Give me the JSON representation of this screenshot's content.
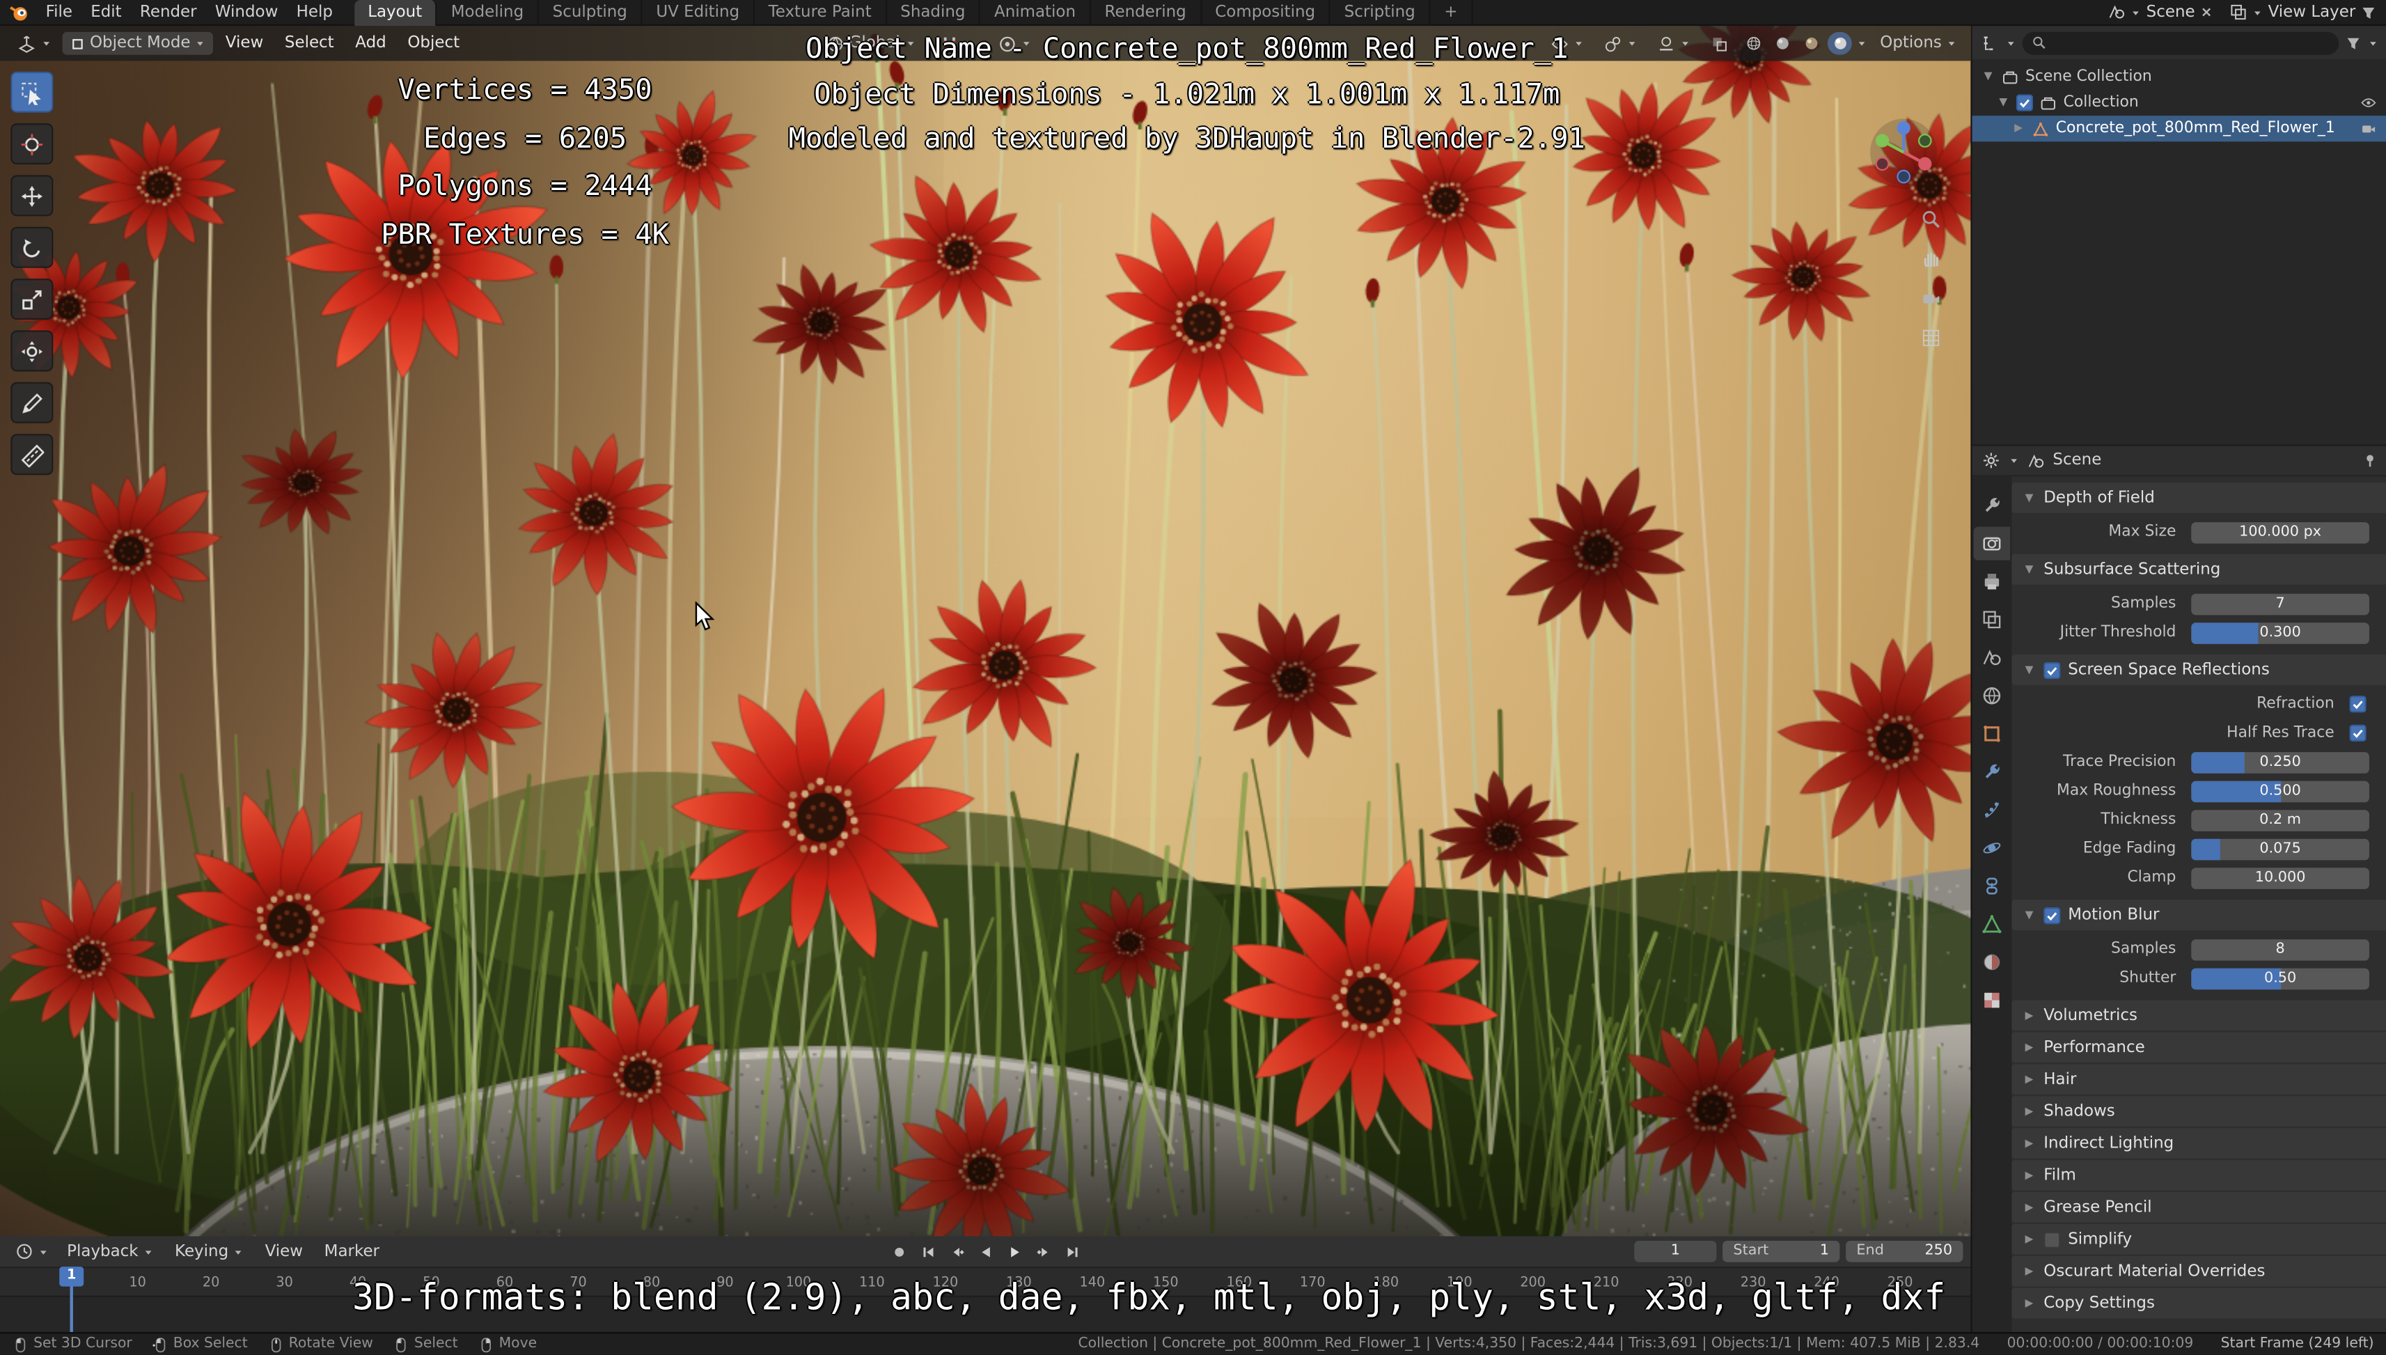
{
  "topbar": {
    "menus": [
      "File",
      "Edit",
      "Render",
      "Window",
      "Help"
    ],
    "tabs": [
      {
        "label": "Layout",
        "active": true
      },
      {
        "label": "Modeling"
      },
      {
        "label": "Sculpting"
      },
      {
        "label": "UV Editing"
      },
      {
        "label": "Texture Paint"
      },
      {
        "label": "Shading"
      },
      {
        "label": "Animation"
      },
      {
        "label": "Rendering"
      },
      {
        "label": "Compositing"
      },
      {
        "label": "Scripting"
      },
      {
        "label": "+"
      }
    ],
    "scene_selector": {
      "icon": "scene-small",
      "label": "Scene",
      "clear_icon": "x"
    },
    "view_layer_selector": {
      "icon": "viewlayer",
      "label": "View Layer",
      "filter_icon": "funnel"
    }
  },
  "viewport_header": {
    "editor_icon": "editor-3dview",
    "mode_selector": {
      "icon": "square",
      "label": "Object Mode"
    },
    "menus": [
      "View",
      "Select",
      "Add",
      "Object"
    ],
    "orientation": {
      "icon": "globe",
      "label": "Global"
    },
    "snap_icon": "magnet",
    "proportional_icon": "prop-circle",
    "right_groups": [
      "visibility",
      "gizmo2",
      "overlays"
    ],
    "xray_icon": "xray",
    "shading_modes": [
      "sphere-wire",
      "sphere-solid",
      "sphere-mat",
      "sphere-rend"
    ],
    "active_shading": "sphere-rend",
    "options_label": "Options"
  },
  "toolbar": {
    "tools": [
      {
        "name": "select-box",
        "active": true
      },
      {
        "name": "cursor3d"
      },
      {
        "name": "move"
      },
      {
        "name": "rotate"
      },
      {
        "name": "scale"
      },
      {
        "name": "transform"
      },
      {
        "name": "annotate"
      },
      {
        "name": "measure"
      }
    ]
  },
  "viewport": {
    "stats_overlay": [
      "Vertices = 4350",
      "Edges = 6205",
      "Polygons = 2444",
      "PBR Textures = 4K"
    ],
    "title_overlay": [
      "Object Name - Concrete_pot_800mm_Red_Flower_1",
      "Object Dimensions - 1.021m x 1.001m x 1.117m",
      "Modeled and textured by 3DHaupt in Blender-2.91"
    ],
    "nav_icons": [
      "zoom",
      "hand",
      "camera",
      "grid"
    ]
  },
  "formats_overlay": "3D-formats: blend (2.9), abc, dae, fbx, mtl, obj, ply, stl, x3d, gltf, dxf",
  "outliner": {
    "rows": [
      {
        "label": "Scene Collection",
        "icon": "collection",
        "expander": "open",
        "level": 0
      },
      {
        "label": "Collection",
        "icon": "collection",
        "expander": "open",
        "level": 1,
        "checkbox": true,
        "checked": true,
        "right_icons": [
          "eye"
        ]
      },
      {
        "label": "Concrete_pot_800mm_Red_Flower_1",
        "icon": "mesh-obj",
        "expander": "closed",
        "level": 2,
        "selected": true,
        "right_icons": [
          "camera"
        ]
      }
    ]
  },
  "properties": {
    "header": {
      "breadcrumb": "Scene"
    },
    "tabs": [
      "tool",
      "render",
      "output",
      "viewlayer",
      "scene",
      "world",
      "object",
      "modifiers",
      "particles",
      "physics",
      "constraints",
      "data",
      "material",
      "texture"
    ],
    "active_tab": "render",
    "panels": [
      {
        "label": "Depth of Field",
        "expanded": true,
        "rows": [
          {
            "label": "Max Size",
            "value": "100.000 px",
            "widget": "field"
          }
        ]
      },
      {
        "label": "Subsurface Scattering",
        "expanded": true,
        "rows": [
          {
            "label": "Samples",
            "value": "7",
            "widget": "field"
          },
          {
            "label": "Jitter Threshold",
            "value": "0.300",
            "widget": "slider",
            "fill": 0.38
          }
        ]
      },
      {
        "label": "Screen Space Reflections",
        "expanded": true,
        "checked": true,
        "rows": [
          {
            "label": "Refraction",
            "widget": "check",
            "checked": true
          },
          {
            "label": "Half Res Trace",
            "widget": "check",
            "checked": true
          },
          {
            "label": "Trace Precision",
            "value": "0.250",
            "widget": "slider",
            "fill": 0.3
          },
          {
            "label": "Max Roughness",
            "value": "0.500",
            "widget": "slider",
            "fill": 0.5
          },
          {
            "label": "Thickness",
            "value": "0.2 m",
            "widget": "field"
          },
          {
            "label": "Edge Fading",
            "value": "0.075",
            "widget": "slider",
            "fill": 0.16
          },
          {
            "label": "Clamp",
            "value": "10.000",
            "widget": "field"
          }
        ]
      },
      {
        "label": "Motion Blur",
        "expanded": true,
        "checked": true,
        "rows": [
          {
            "label": "Samples",
            "value": "8",
            "widget": "field"
          },
          {
            "label": "Shutter",
            "value": "0.50",
            "widget": "slider",
            "fill": 0.5
          }
        ]
      },
      {
        "label": "Volumetrics"
      },
      {
        "label": "Performance"
      },
      {
        "label": "Hair"
      },
      {
        "label": "Shadows"
      },
      {
        "label": "Indirect Lighting"
      },
      {
        "label": "Film"
      },
      {
        "label": "Grease Pencil"
      },
      {
        "label": "Simplify",
        "checked": false
      },
      {
        "label": "Oscurart Material Overrides"
      },
      {
        "label": "Copy Settings"
      }
    ]
  },
  "timeline": {
    "menus": [
      {
        "label": "Playback",
        "chevron": true
      },
      {
        "label": "Keying",
        "chevron": true
      },
      {
        "label": "View"
      },
      {
        "label": "Marker"
      }
    ],
    "transport": [
      "record",
      "skip-start",
      "key-prev",
      "play-rev",
      "play",
      "key-next",
      "skip-end"
    ],
    "current_frame": "1",
    "fields": [
      {
        "label": "Start",
        "value": "1"
      },
      {
        "label": "End",
        "value": "250"
      }
    ],
    "ticks": [
      1,
      10,
      20,
      30,
      40,
      50,
      60,
      70,
      80,
      90,
      100,
      110,
      120,
      130,
      140,
      150,
      160,
      170,
      180,
      190,
      200,
      210,
      220,
      230,
      240,
      250
    ]
  },
  "statusbar": {
    "hints": [
      {
        "icon": "mouse-left",
        "label": "Set 3D Cursor"
      },
      {
        "icon": "mouse-drag",
        "label": "Box Select"
      },
      {
        "icon": "mouse-middle",
        "label": "Rotate View"
      },
      {
        "icon": "mouse-left",
        "label": "Select"
      },
      {
        "icon": "mouse-right",
        "label": "Move"
      }
    ],
    "stats": "Collection | Concrete_pot_800mm_Red_Flower_1 | Verts:4,350 | Faces:2,444 | Tris:3,691 | Objects:1/1 | Mem: 407.5 MiB | 2.83.4",
    "time": "00:00:00:00 / 00:00:10:09",
    "report": "Start Frame (249 left)"
  },
  "colors": {
    "accent": "#4772b3",
    "selection": "#3a5d85",
    "flower_red": "#c4251a",
    "wall_tan": "#d0ad72"
  }
}
